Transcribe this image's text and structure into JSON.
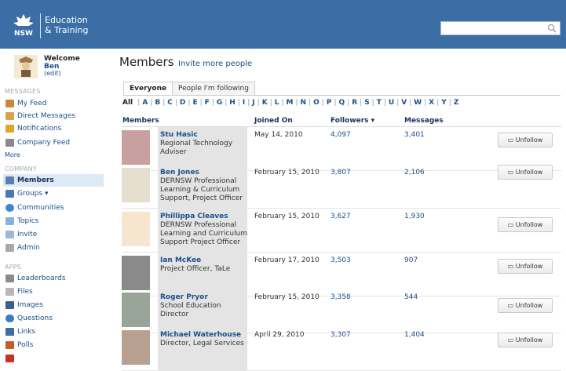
{
  "header": {
    "org": "NSW",
    "brand_line1": "Education",
    "brand_line2": "& Training",
    "search_placeholder": ""
  },
  "sidebar": {
    "welcome": "Welcome",
    "user_name": "Ben",
    "edit_label": "(edit)",
    "sections": {
      "messages": "MESSAGES",
      "company": "COMPANY",
      "apps": "APPS"
    },
    "messages_items": [
      {
        "label": "My Feed",
        "icon": "home-icon"
      },
      {
        "label": "Direct Messages",
        "icon": "direct-message-icon"
      },
      {
        "label": "Notifications",
        "icon": "notification-icon"
      },
      {
        "label": "Company Feed",
        "icon": "company-feed-icon"
      }
    ],
    "more_label": "More",
    "company_items": [
      {
        "label": "Members",
        "icon": "member-icon",
        "active": true
      },
      {
        "label": "Groups ▾",
        "icon": "groups-icon"
      },
      {
        "label": "Communities",
        "icon": "globe-icon"
      },
      {
        "label": "Topics",
        "icon": "tag-icon"
      },
      {
        "label": "Invite",
        "icon": "envelope-icon"
      },
      {
        "label": "Admin",
        "icon": "wrench-icon"
      }
    ],
    "apps_items": [
      {
        "label": "Leaderboards",
        "icon": "leaderboard-icon"
      },
      {
        "label": "Files",
        "icon": "paperclip-icon"
      },
      {
        "label": "Images",
        "icon": "image-icon"
      },
      {
        "label": "Questions",
        "icon": "question-icon"
      },
      {
        "label": "Links",
        "icon": "link-icon"
      },
      {
        "label": "Polls",
        "icon": "poll-icon"
      }
    ]
  },
  "main": {
    "title": "Members",
    "invite_link": "Invite more people",
    "tabs": [
      "Everyone",
      "People I'm following"
    ],
    "alphabet": {
      "all": "All",
      "letters": [
        "A",
        "B",
        "C",
        "D",
        "E",
        "F",
        "G",
        "H",
        "I",
        "J",
        "K",
        "L",
        "M",
        "N",
        "O",
        "P",
        "Q",
        "R",
        "S",
        "T",
        "U",
        "V",
        "W",
        "X",
        "Y",
        "Z"
      ]
    },
    "columns": {
      "members": "Members",
      "joined": "Joined On",
      "followers": "Followers ▾",
      "messages": "Messages"
    },
    "unfollow_label": "Unfollow",
    "rows": [
      {
        "name": "Stu Hasic",
        "role": "Regional Technology Adviser",
        "joined": "May 14, 2010",
        "followers": "4,097",
        "messages": "3,401"
      },
      {
        "name": "Ben Jones",
        "role": "DERNSW Professional Learning & Curriculum Support, Project Officer",
        "joined": "February 15, 2010",
        "followers": "3,807",
        "messages": "2,106"
      },
      {
        "name": "Phillippa Cleaves",
        "role": "DERNSW Professional Learning and Curriculum Support Project Officer",
        "joined": "February 15, 2010",
        "followers": "3,627",
        "messages": "1,930"
      },
      {
        "name": "Ian McKee",
        "role": "Project Officer, TaLe",
        "joined": "February 17, 2010",
        "followers": "3,503",
        "messages": "907"
      },
      {
        "name": "Roger Pryor",
        "role": "School Education Director",
        "joined": "February 15, 2010",
        "followers": "3,358",
        "messages": "544"
      },
      {
        "name": "Michael Waterhouse",
        "role": "Director, Legal Services",
        "joined": "April 29, 2010",
        "followers": "3,307",
        "messages": "1,404"
      }
    ]
  },
  "colors": {
    "header_bg": "#3a6ea5",
    "link": "#1a4f8b",
    "active_nav_bg": "#dde9f5"
  }
}
